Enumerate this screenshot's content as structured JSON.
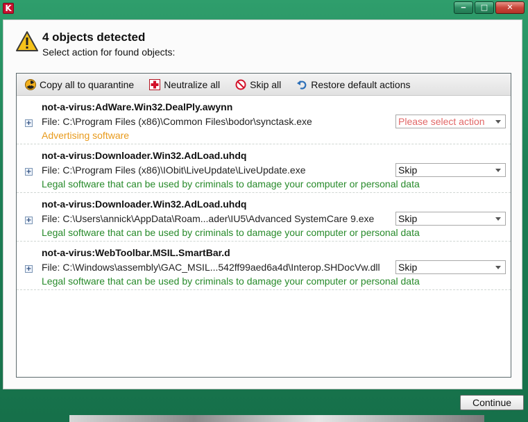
{
  "window": {
    "logo_letter": "K",
    "controls": {
      "minimize": "‒",
      "maximize": "□",
      "close": "✕"
    }
  },
  "header": {
    "title": "4 objects detected",
    "subtitle": "Select action for found objects:"
  },
  "toolbar": {
    "quarantine_label": "Copy all to quarantine",
    "neutralize_label": "Neutralize all",
    "skip_label": "Skip all",
    "restore_label": "Restore default actions"
  },
  "threats": [
    {
      "name": "not-a-virus:AdWare.Win32.DealPly.awynn",
      "file": "File: C:\\Program Files (x86)\\Common Files\\bodor\\synctask.exe",
      "description": "Advertising software",
      "action": "Please select action"
    },
    {
      "name": "not-a-virus:Downloader.Win32.AdLoad.uhdq",
      "file": "File: C:\\Program Files (x86)\\IObit\\LiveUpdate\\LiveUpdate.exe",
      "description": "Legal software that can be used by criminals to damage your computer or personal data",
      "action": "Skip"
    },
    {
      "name": "not-a-virus:Downloader.Win32.AdLoad.uhdq",
      "file": "File: C:\\Users\\annick\\AppData\\Roam...ader\\IU5\\Advanced SystemCare 9.exe",
      "description": "Legal software that can be used by criminals to damage your computer or personal data",
      "action": "Skip"
    },
    {
      "name": "not-a-virus:WebToolbar.MSIL.SmartBar.d",
      "file": "File: C:\\Windows\\assembly\\GAC_MSIL...542ff99aed6a4d\\Interop.SHDocVw.dll",
      "description": "Legal software that can be used by criminals to damage your computer or personal data",
      "action": "Skip"
    }
  ],
  "footer": {
    "continue_label": "Continue"
  },
  "colors": {
    "frame": "#1d7f55",
    "advertising": "#e89a1b",
    "legal_warning": "#278a2a",
    "placeholder": "#e26767"
  }
}
